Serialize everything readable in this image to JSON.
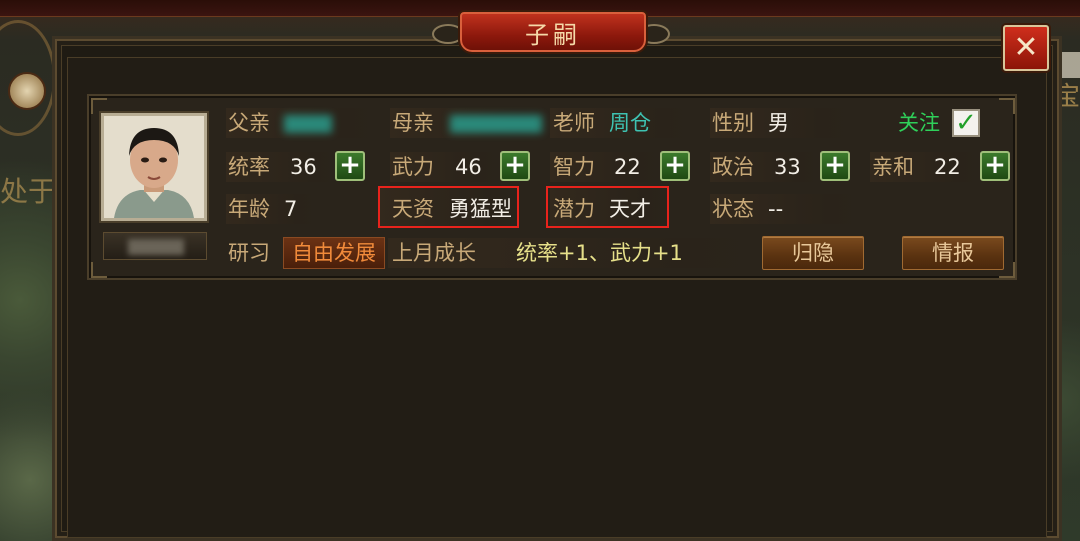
{
  "title": "子嗣",
  "close_symbol": "✕",
  "child": {
    "father_label": "父亲",
    "mother_label": "母亲",
    "teacher_label": "老师",
    "teacher_value": "周仓",
    "gender_label": "性别",
    "gender_value": "男",
    "follow_label": "关注",
    "follow_checked": true,
    "check_symbol": "✓"
  },
  "stats": {
    "command_label": "统率",
    "command_value": "36",
    "force_label": "武力",
    "force_value": "46",
    "intellect_label": "智力",
    "intellect_value": "22",
    "politics_label": "政治",
    "politics_value": "33",
    "affinity_label": "亲和",
    "affinity_value": "22",
    "plus_symbol": "+"
  },
  "traits": {
    "age_label": "年龄",
    "age_value": "7",
    "talent_label": "天资",
    "talent_value": "勇猛型",
    "potential_label": "潜力",
    "potential_value": "天才",
    "status_label": "状态",
    "status_value": "--"
  },
  "study": {
    "study_label": "研习",
    "mode_button": "自由发展",
    "growth_label": "上月成长",
    "growth_value": "统率+1、武力+1"
  },
  "actions": {
    "retire_button": "归隐",
    "intel_button": "情报"
  },
  "map_text": {
    "left": "处于",
    "right": "宝"
  },
  "colors": {
    "label": "#c8a978",
    "value": "#f2eee6",
    "teal": "#3ec2b2",
    "follow_green": "#2fd05a",
    "highlight_red": "#e8231c",
    "title_red": "#b8281a"
  }
}
